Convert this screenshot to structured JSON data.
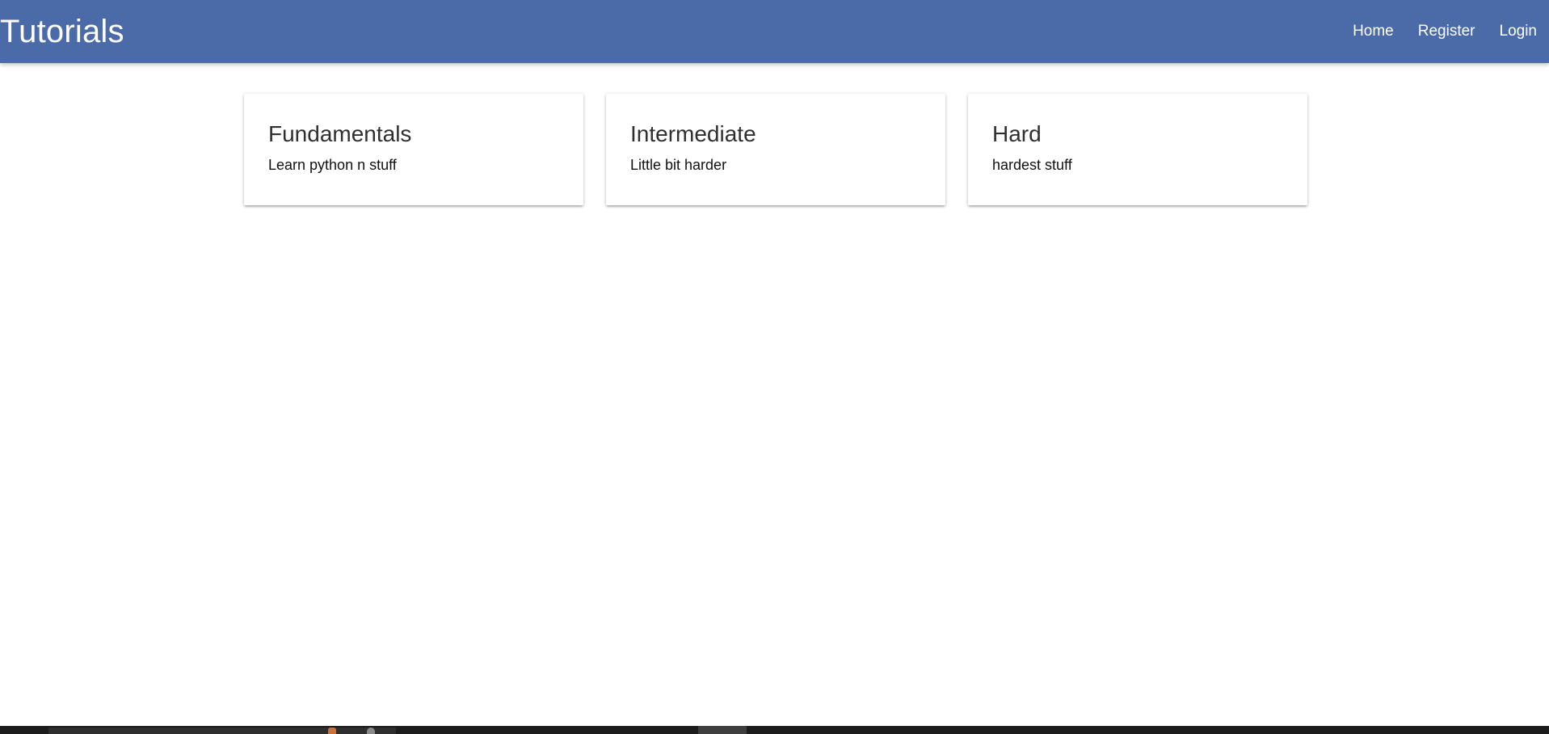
{
  "navbar": {
    "brand": "Tutorials",
    "background_color": "#4a6aa8",
    "links": [
      {
        "label": "Home"
      },
      {
        "label": "Register"
      },
      {
        "label": "Login"
      }
    ]
  },
  "cards": [
    {
      "title": "Fundamentals",
      "text": "Learn python n stuff"
    },
    {
      "title": "Intermediate",
      "text": "Little bit harder"
    },
    {
      "title": "Hard",
      "text": "hardest stuff"
    }
  ],
  "taskbar": {
    "icons": [
      "firefox-icon",
      "settings-icon"
    ]
  }
}
